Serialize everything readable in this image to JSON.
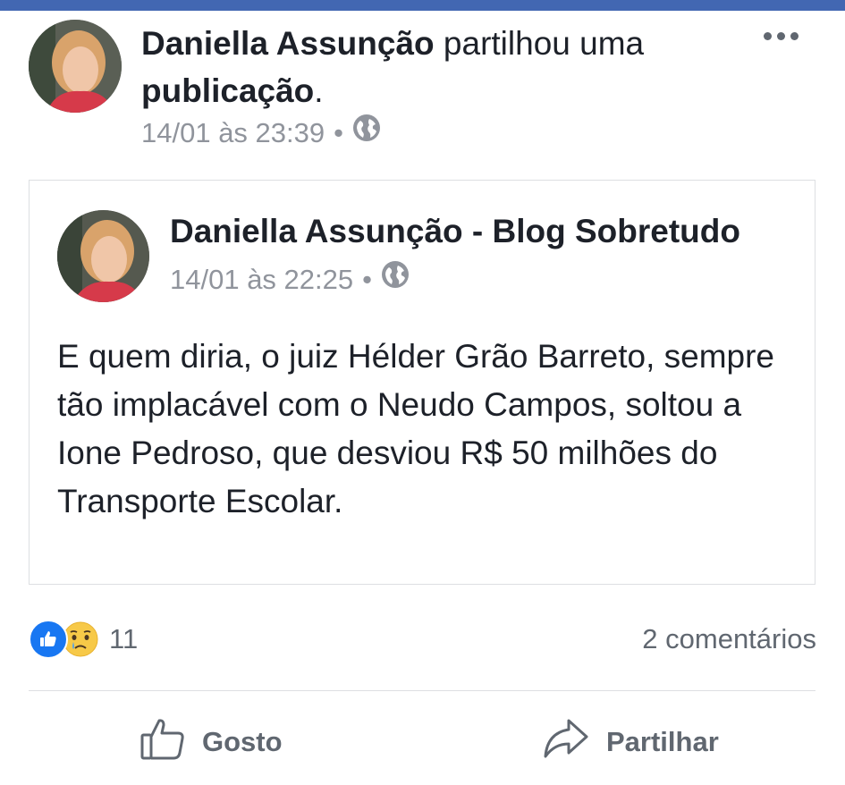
{
  "header": {
    "author": "Daniella Assunção",
    "action_text": " partilhou uma ",
    "object": "publicação",
    "punct": ".",
    "timestamp": "14/01 às 23:39",
    "separator": "•",
    "privacy_icon": "globe-icon",
    "menu_icon": "more-dots-icon"
  },
  "shared_post": {
    "author": "Daniella Assunção - Blog Sobretudo",
    "timestamp": "14/01 às 22:25",
    "separator": "•",
    "privacy_icon": "globe-icon",
    "text": "E quem diria, o juiz Hélder Grão Barreto, sempre tão implacável com o Neudo Campos, soltou a Ione Pedroso, que desviou R$ 50 milhões do Transporte Escolar."
  },
  "stats": {
    "reaction_icons": [
      "like-reaction-icon",
      "sad-reaction-icon"
    ],
    "reaction_count": "11",
    "comments": "2 comentários"
  },
  "actions": {
    "like_label": "Gosto",
    "share_label": "Partilhar"
  },
  "colors": {
    "brand": "#4267b2",
    "like_blue": "#1877f2",
    "meta_gray": "#90949c"
  }
}
